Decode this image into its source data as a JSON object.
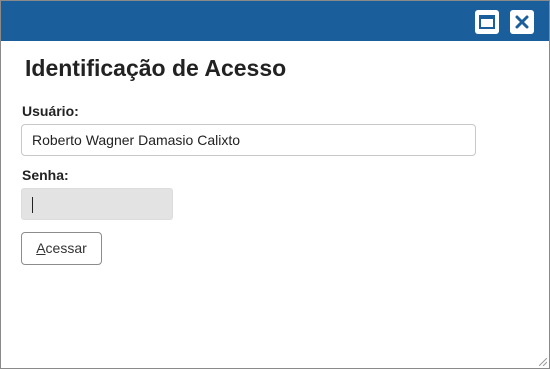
{
  "window": {
    "titlebar_color": "#1a5e9c",
    "maximize_icon": "maximize-icon",
    "close_icon": "close-icon"
  },
  "title": "Identificação de Acesso",
  "form": {
    "username_label": "Usuário:",
    "username_value": "Roberto Wagner Damasio Calixto",
    "password_label": "Senha:",
    "password_value": "",
    "submit_mnemonic": "A",
    "submit_rest": "cessar"
  }
}
